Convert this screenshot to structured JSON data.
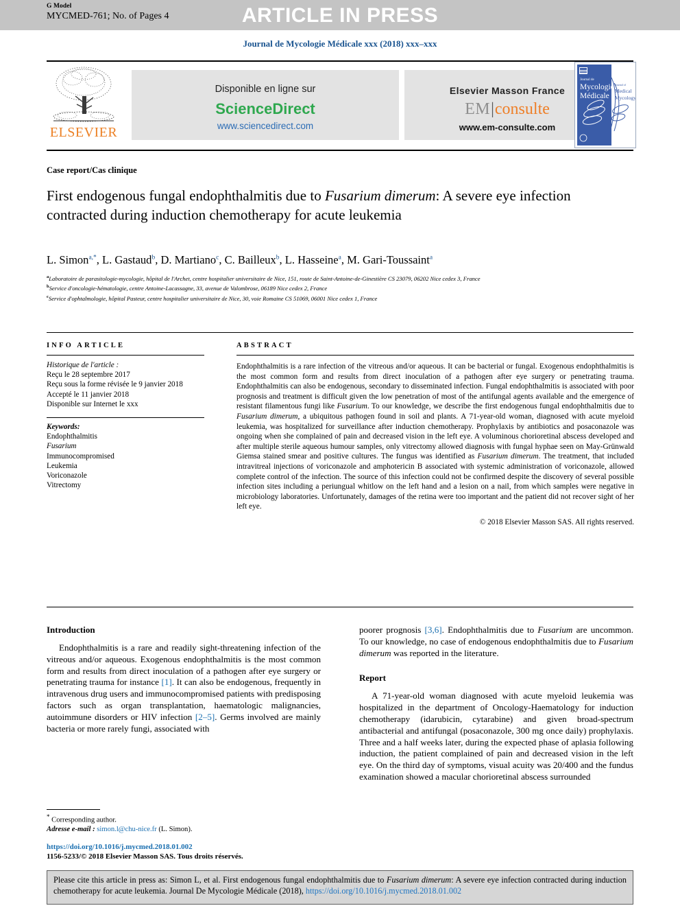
{
  "header": {
    "g_model": "G Model",
    "manuscript_id": "MYCMED-761; No. of Pages 4",
    "article_in_press": "ARTICLE IN PRESS",
    "journal_line": "Journal de Mycologie Médicale xxx (2018) xxx–xxx"
  },
  "publisher_band": {
    "elsevier_wordmark": "ELSEVIER",
    "sciencedirect": {
      "available_text": "Disponible en ligne sur",
      "brand": "ScienceDirect",
      "url": "www.sciencedirect.com"
    },
    "em_consulte": {
      "publisher_text": "Elsevier Masson France",
      "brand_em": "EM",
      "brand_consulte": "consulte",
      "url": "www.em-consulte.com"
    },
    "cover_thumbnail": {
      "line1": "Journal de",
      "line2": "Mycologie",
      "line3": "Médicale",
      "side1": "Journal of",
      "side2": "Medical",
      "side3": "Mycology"
    }
  },
  "article": {
    "section_label": "Case report/Cas clinique",
    "title_part1": "First endogenous fungal endophthalmitis due to ",
    "title_italic1": "Fusarium dimerum",
    "title_part2": ": A severe eye infection contracted during induction chemotherapy for acute leukemia",
    "authors": [
      {
        "name": "L. Simon",
        "sup": "a,*"
      },
      {
        "name": "L. Gastaud",
        "sup": "b"
      },
      {
        "name": "D. Martiano",
        "sup": "c"
      },
      {
        "name": "C. Bailleux",
        "sup": "b"
      },
      {
        "name": "L. Hasseine",
        "sup": "a"
      },
      {
        "name": "M. Gari-Toussaint",
        "sup": "a"
      }
    ],
    "affiliations": [
      {
        "marker": "a",
        "text": "Laboratoire de parasitologie-mycologie, hôpital de l'Archet, centre hospitalier universitaire de Nice, 151, route de Saint-Antoine-de-Ginestière CS 23079, 06202 Nice cedex 3, France"
      },
      {
        "marker": "b",
        "text": "Service d'oncologie-hématologie, centre Antoine-Lacassagne, 33, avenue de Valombrose, 06189 Nice cedex 2, France"
      },
      {
        "marker": "c",
        "text": "Service d'ophtalmologie, hôpital Pasteur, centre hospitalier universitaire de Nice, 30, voie Romaine CS 51069, 06001 Nice cedex 1, France"
      }
    ]
  },
  "info_article": {
    "heading": "INFO ARTICLE",
    "history_title": "Historique de l'article :",
    "history_lines": [
      "Reçu le 28 septembre 2017",
      "Reçu sous la forme révisée le 9 janvier 2018",
      "Accepté le 11 janvier 2018",
      "Disponible sur Internet le xxx"
    ],
    "keywords_title": "Keywords:",
    "keywords": [
      "Endophthalmitis",
      "Fusarium",
      "Immunocompromised",
      "Leukemia",
      "Voriconazole",
      "Vitrectomy"
    ],
    "keywords_italic_index": 1
  },
  "abstract": {
    "heading": "ABSTRACT",
    "p1": "Endophthalmitis is a rare infection of the vitreous and/or aqueous. It can be bacterial or fungal. Exogenous endophthalmitis is the most common form and results from direct inoculation of a pathogen after eye surgery or penetrating trauma. Endophthalmitis can also be endogenous, secondary to disseminated infection. Fungal endophthalmitis is associated with poor prognosis and treatment is difficult given the low penetration of most of the antifungal agents available and the emergence of resistant filamentous fungi like ",
    "i1": "Fusarium",
    "p2": ". To our knowledge, we describe the first endogenous fungal endophthalmitis due to ",
    "i2": "Fusarium dimerum",
    "p3": ", a ubiquitous pathogen found in soil and plants. A 71-year-old woman, diagnosed with acute myeloid leukemia, was hospitalized for surveillance after induction chemotherapy. Prophylaxis by antibiotics and posaconazole was ongoing when she complained of pain and decreased vision in the left eye. A voluminous chorioretinal abscess developed and after multiple sterile aqueous humour samples, only vitrectomy allowed diagnosis with fungal hyphae seen on May-Grünwald Giemsa stained smear and positive cultures. The fungus was identified as ",
    "i3": "Fusarium dimerum",
    "p4": ". The treatment, that included intravitreal injections of voriconazole and amphotericin B associated with systemic administration of voriconazole, allowed complete control of the infection. The source of this infection could not be confirmed despite the discovery of several possible infection sites including a periungual whitlow on the left hand and a lesion on a nail, from which samples were negative in microbiology laboratories. Unfortunately, damages of the retina were too important and the patient did not recover sight of her left eye.",
    "copyright": "© 2018 Elsevier Masson SAS. All rights reserved."
  },
  "body": {
    "introduction_heading": "Introduction",
    "intro_p1_a": "Endophthalmitis is a rare and readily sight-threatening infection of the vitreous and/or aqueous. Exogenous endophthalmitis is the most common form and results from direct inoculation of a pathogen after eye surgery or penetrating trauma for instance ",
    "intro_ref1": "[1]",
    "intro_p1_b": ". It can also be endogenous, frequently in intravenous drug users and immunocompromised patients with predisposing factors such as organ transplantation, haematologic malignancies, autoimmune disorders or HIV infection ",
    "intro_ref2": "[2–5]",
    "intro_p1_c": ". Germs involved are mainly bacteria or more rarely fungi, associated with",
    "right_p1_a": "poorer prognosis ",
    "right_ref1": "[3,6]",
    "right_p1_b": ". Endophthalmitis due to ",
    "right_i1": "Fusarium",
    "right_p1_c": " are uncommon. To our knowledge, no case of endogenous endophthalmitis due to ",
    "right_i2": "Fusarium dimerum",
    "right_p1_d": " was reported in the literature.",
    "report_heading": "Report",
    "report_p1": "A 71-year-old woman diagnosed with acute myeloid leukemia was hospitalized in the department of Oncology-Haematology for induction chemotherapy (idarubicin, cytarabine) and given broad-spectrum antibacterial and antifungal (posaconazole, 300 mg once daily) prophylaxis. Three and a half weeks later, during the expected phase of aplasia following induction, the patient complained of pain and decreased vision in the left eye. On the third day of symptoms, visual acuity was 20/400 and the fundus examination showed a macular chorioretinal abscess surrounded"
  },
  "footer": {
    "corresponding_marker": "*",
    "corresponding_label": " Corresponding author.",
    "email_label": "Adresse e-mail :",
    "email": "simon.l@chu-nice.fr",
    "email_suffix": " (L. Simon).",
    "doi_url": "https://doi.org/10.1016/j.mycmed.2018.01.002",
    "issn_line": "1156-5233/© 2018 Elsevier Masson SAS. Tous droits réservés."
  },
  "cite_box": {
    "text_a": "Please cite this article in press as: Simon L, et al. First endogenous fungal endophthalmitis due to ",
    "italic_a": "Fusarium dimerum",
    "text_b": ": A severe eye infection contracted during induction chemotherapy for acute leukemia. Journal De Mycologie Médicale (2018), ",
    "link": "https://doi.org/10.1016/j.mycmed.2018.01.002"
  },
  "colors": {
    "journal_blue": "#1a5490",
    "link_blue": "#1a6fb0",
    "sciencedirect_green": "#2fa84f",
    "elsevier_orange": "#ec8024",
    "consulte_orange": "#ee7f28",
    "banner_grey": "#c4c4c4",
    "box_grey": "#d6d6d6",
    "cover_blue": "#3a5ca8"
  }
}
